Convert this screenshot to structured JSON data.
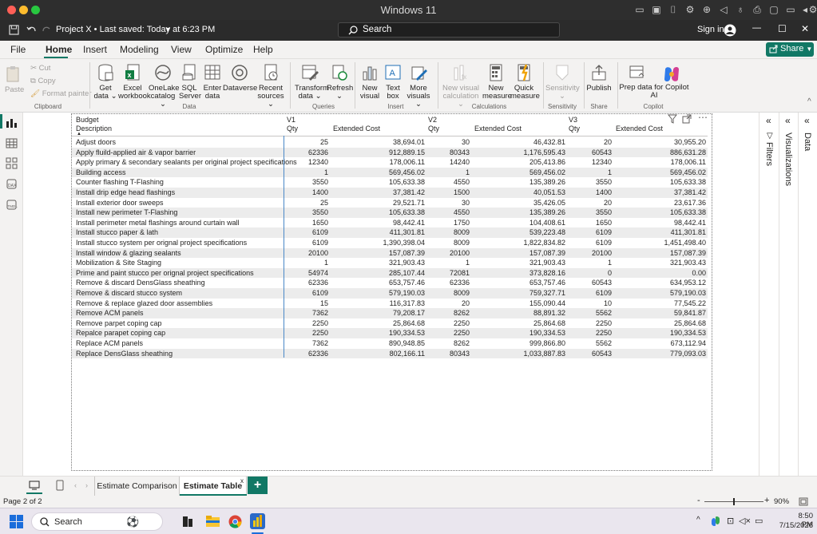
{
  "os": {
    "window_title": "Windows 11"
  },
  "app": {
    "project_title": "Project X • Last saved: Today at 6:23 PM",
    "search_label": "Search",
    "user_label": "Sign in"
  },
  "menu": [
    "File",
    "Home",
    "Insert",
    "Modeling",
    "View",
    "Optimize",
    "Help"
  ],
  "share_label": "Share",
  "ribbon": {
    "clipboard": {
      "paste": "Paste",
      "cut": "Cut",
      "copy": "Copy",
      "format_painter": "Format painter",
      "group": "Clipboard"
    },
    "data": {
      "group": "Data",
      "buttons": [
        {
          "l1": "Get",
          "l2": "data ⌄"
        },
        {
          "l1": "Excel",
          "l2": "workbook"
        },
        {
          "l1": "OneLake",
          "l2": "catalog ⌄"
        },
        {
          "l1": "SQL",
          "l2": "Server"
        },
        {
          "l1": "Enter",
          "l2": "data"
        },
        {
          "l1": "Dataverse",
          "l2": ""
        },
        {
          "l1": "Recent",
          "l2": "sources ⌄"
        }
      ]
    },
    "queries": {
      "group": "Queries",
      "buttons": [
        {
          "l1": "Transform",
          "l2": "data ⌄"
        },
        {
          "l1": "Refresh",
          "l2": "⌄"
        }
      ]
    },
    "insert": {
      "group": "Insert",
      "buttons": [
        {
          "l1": "New",
          "l2": "visual"
        },
        {
          "l1": "Text",
          "l2": "box"
        },
        {
          "l1": "More",
          "l2": "visuals ⌄"
        }
      ]
    },
    "calculations": {
      "group": "Calculations",
      "buttons": [
        {
          "l1": "New visual",
          "l2": "calculation ⌄"
        },
        {
          "l1": "New",
          "l2": "measure"
        },
        {
          "l1": "Quick",
          "l2": "measure"
        }
      ]
    },
    "sensitivity": {
      "group": "Sensitivity",
      "buttons": [
        {
          "l1": "Sensitivity",
          "l2": "⌄"
        }
      ]
    },
    "share": {
      "group": "Share",
      "buttons": [
        {
          "l1": "Publish",
          "l2": ""
        }
      ]
    },
    "copilot": {
      "group": "Copilot",
      "buttons": [
        {
          "l1": "Prep data for Copilot",
          "l2": "AI"
        }
      ]
    }
  },
  "table": {
    "header_row1": {
      "rowgroup": "Budget",
      "v1": "V1",
      "v2": "V2",
      "v3": "V3"
    },
    "header_row2": {
      "desc": "Description",
      "qty": "Qty",
      "ext": "Extended Cost"
    },
    "rows": [
      [
        "Adjust doors",
        "25",
        "38,694.01",
        "30",
        "46,432.81",
        "20",
        "30,955.20"
      ],
      [
        "Apply fluild-applied air & vapor barrier",
        "62336",
        "912,889.15",
        "80343",
        "1,176,595.43",
        "60543",
        "886,631.28"
      ],
      [
        "Apply primary & secondary sealants per original project specifications",
        "12340",
        "178,006.11",
        "14240",
        "205,413.86",
        "12340",
        "178,006.11"
      ],
      [
        "Building access",
        "1",
        "569,456.02",
        "1",
        "569,456.02",
        "1",
        "569,456.02"
      ],
      [
        "Counter flashing T-Flashing",
        "3550",
        "105,633.38",
        "4550",
        "135,389.26",
        "3550",
        "105,633.38"
      ],
      [
        "Install drip edge head flashings",
        "1400",
        "37,381.42",
        "1500",
        "40,051.53",
        "1400",
        "37,381.42"
      ],
      [
        "Install exterior door sweeps",
        "25",
        "29,521.71",
        "30",
        "35,426.05",
        "20",
        "23,617.36"
      ],
      [
        "Install new perimeter T-Flashing",
        "3550",
        "105,633.38",
        "4550",
        "135,389.26",
        "3550",
        "105,633.38"
      ],
      [
        "Install perimeter metal flashings around curtain wall",
        "1650",
        "98,442.41",
        "1750",
        "104,408.61",
        "1650",
        "98,442.41"
      ],
      [
        "Install stucco paper & lath",
        "6109",
        "411,301.81",
        "8009",
        "539,223.48",
        "6109",
        "411,301.81"
      ],
      [
        "Install stucco system per orignal project specifications",
        "6109",
        "1,390,398.04",
        "8009",
        "1,822,834.82",
        "6109",
        "1,451,498.40"
      ],
      [
        "Install window & glazing sealants",
        "20100",
        "157,087.39",
        "20100",
        "157,087.39",
        "20100",
        "157,087.39"
      ],
      [
        "Mobilization & Site Staging",
        "1",
        "321,903.43",
        "1",
        "321,903.43",
        "1",
        "321,903.43"
      ],
      [
        "Prime and paint stucco per orignal project specifications",
        "54974",
        "285,107.44",
        "72081",
        "373,828.16",
        "0",
        "0.00"
      ],
      [
        "Remove & discard DensGlass sheathing",
        "62336",
        "653,757.46",
        "62336",
        "653,757.46",
        "60543",
        "634,953.12"
      ],
      [
        "Remove & discard stucco system",
        "6109",
        "579,190.03",
        "8009",
        "759,327.71",
        "6109",
        "579,190.03"
      ],
      [
        "Remove & replace glazed door assemblies",
        "15",
        "116,317.83",
        "20",
        "155,090.44",
        "10",
        "77,545.22"
      ],
      [
        "Remove ACM panels",
        "7362",
        "79,208.17",
        "8262",
        "88,891.32",
        "5562",
        "59,841.87"
      ],
      [
        "Remove parpet coping cap",
        "2250",
        "25,864.68",
        "2250",
        "25,864.68",
        "2250",
        "25,864.68"
      ],
      [
        "Repalce parapet coping cap",
        "2250",
        "190,334.53",
        "2250",
        "190,334.53",
        "2250",
        "190,334.53"
      ],
      [
        "Replace ACM panels",
        "7362",
        "890,948.85",
        "8262",
        "999,866.80",
        "5562",
        "673,112.94"
      ],
      [
        "Replace DensGlass sheathing",
        "62336",
        "802,166.11",
        "80343",
        "1,033,887.83",
        "60543",
        "779,093.03"
      ]
    ]
  },
  "panes": {
    "filters": "Filters",
    "visualizations": "Visualizations",
    "data": "Data"
  },
  "tabs": [
    {
      "label": "Estimate Comparison",
      "active": false
    },
    {
      "label": "Estimate Table",
      "active": true
    }
  ],
  "status": {
    "page": "Page 2 of 2",
    "zoom": "90%"
  },
  "taskbar": {
    "search": "Search",
    "time": "8:50 PM",
    "date": "7/15/2026"
  }
}
